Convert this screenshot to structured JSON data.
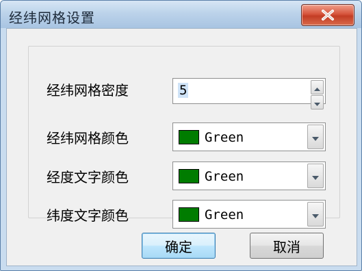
{
  "window": {
    "title": "经纬网格设置",
    "close_icon": "close-x-icon"
  },
  "fields": {
    "density": {
      "label": "经纬网格密度",
      "value": "5"
    },
    "grid_color": {
      "label": "经纬网格颜色",
      "value": "Green",
      "swatch": "#007c00"
    },
    "lon_text_color": {
      "label": "经度文字颜色",
      "value": "Green",
      "swatch": "#007c00"
    },
    "lat_text_color": {
      "label": "纬度文字颜色",
      "value": "Green",
      "swatch": "#007c00"
    }
  },
  "buttons": {
    "ok": "确定",
    "cancel": "取消"
  }
}
